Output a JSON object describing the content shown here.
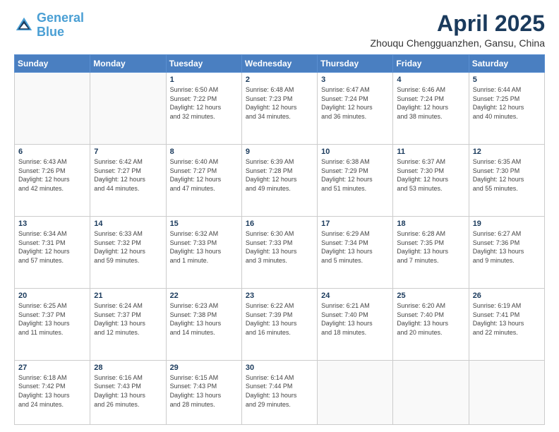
{
  "header": {
    "logo_line1": "General",
    "logo_line2": "Blue",
    "month_title": "April 2025",
    "subtitle": "Zhouqu Chengguanzhen, Gansu, China"
  },
  "weekdays": [
    "Sunday",
    "Monday",
    "Tuesday",
    "Wednesday",
    "Thursday",
    "Friday",
    "Saturday"
  ],
  "rows": [
    [
      {
        "day": "",
        "info": ""
      },
      {
        "day": "",
        "info": ""
      },
      {
        "day": "1",
        "info": "Sunrise: 6:50 AM\nSunset: 7:22 PM\nDaylight: 12 hours\nand 32 minutes."
      },
      {
        "day": "2",
        "info": "Sunrise: 6:48 AM\nSunset: 7:23 PM\nDaylight: 12 hours\nand 34 minutes."
      },
      {
        "day": "3",
        "info": "Sunrise: 6:47 AM\nSunset: 7:24 PM\nDaylight: 12 hours\nand 36 minutes."
      },
      {
        "day": "4",
        "info": "Sunrise: 6:46 AM\nSunset: 7:24 PM\nDaylight: 12 hours\nand 38 minutes."
      },
      {
        "day": "5",
        "info": "Sunrise: 6:44 AM\nSunset: 7:25 PM\nDaylight: 12 hours\nand 40 minutes."
      }
    ],
    [
      {
        "day": "6",
        "info": "Sunrise: 6:43 AM\nSunset: 7:26 PM\nDaylight: 12 hours\nand 42 minutes."
      },
      {
        "day": "7",
        "info": "Sunrise: 6:42 AM\nSunset: 7:27 PM\nDaylight: 12 hours\nand 44 minutes."
      },
      {
        "day": "8",
        "info": "Sunrise: 6:40 AM\nSunset: 7:27 PM\nDaylight: 12 hours\nand 47 minutes."
      },
      {
        "day": "9",
        "info": "Sunrise: 6:39 AM\nSunset: 7:28 PM\nDaylight: 12 hours\nand 49 minutes."
      },
      {
        "day": "10",
        "info": "Sunrise: 6:38 AM\nSunset: 7:29 PM\nDaylight: 12 hours\nand 51 minutes."
      },
      {
        "day": "11",
        "info": "Sunrise: 6:37 AM\nSunset: 7:30 PM\nDaylight: 12 hours\nand 53 minutes."
      },
      {
        "day": "12",
        "info": "Sunrise: 6:35 AM\nSunset: 7:30 PM\nDaylight: 12 hours\nand 55 minutes."
      }
    ],
    [
      {
        "day": "13",
        "info": "Sunrise: 6:34 AM\nSunset: 7:31 PM\nDaylight: 12 hours\nand 57 minutes."
      },
      {
        "day": "14",
        "info": "Sunrise: 6:33 AM\nSunset: 7:32 PM\nDaylight: 12 hours\nand 59 minutes."
      },
      {
        "day": "15",
        "info": "Sunrise: 6:32 AM\nSunset: 7:33 PM\nDaylight: 13 hours\nand 1 minute."
      },
      {
        "day": "16",
        "info": "Sunrise: 6:30 AM\nSunset: 7:33 PM\nDaylight: 13 hours\nand 3 minutes."
      },
      {
        "day": "17",
        "info": "Sunrise: 6:29 AM\nSunset: 7:34 PM\nDaylight: 13 hours\nand 5 minutes."
      },
      {
        "day": "18",
        "info": "Sunrise: 6:28 AM\nSunset: 7:35 PM\nDaylight: 13 hours\nand 7 minutes."
      },
      {
        "day": "19",
        "info": "Sunrise: 6:27 AM\nSunset: 7:36 PM\nDaylight: 13 hours\nand 9 minutes."
      }
    ],
    [
      {
        "day": "20",
        "info": "Sunrise: 6:25 AM\nSunset: 7:37 PM\nDaylight: 13 hours\nand 11 minutes."
      },
      {
        "day": "21",
        "info": "Sunrise: 6:24 AM\nSunset: 7:37 PM\nDaylight: 13 hours\nand 12 minutes."
      },
      {
        "day": "22",
        "info": "Sunrise: 6:23 AM\nSunset: 7:38 PM\nDaylight: 13 hours\nand 14 minutes."
      },
      {
        "day": "23",
        "info": "Sunrise: 6:22 AM\nSunset: 7:39 PM\nDaylight: 13 hours\nand 16 minutes."
      },
      {
        "day": "24",
        "info": "Sunrise: 6:21 AM\nSunset: 7:40 PM\nDaylight: 13 hours\nand 18 minutes."
      },
      {
        "day": "25",
        "info": "Sunrise: 6:20 AM\nSunset: 7:40 PM\nDaylight: 13 hours\nand 20 minutes."
      },
      {
        "day": "26",
        "info": "Sunrise: 6:19 AM\nSunset: 7:41 PM\nDaylight: 13 hours\nand 22 minutes."
      }
    ],
    [
      {
        "day": "27",
        "info": "Sunrise: 6:18 AM\nSunset: 7:42 PM\nDaylight: 13 hours\nand 24 minutes."
      },
      {
        "day": "28",
        "info": "Sunrise: 6:16 AM\nSunset: 7:43 PM\nDaylight: 13 hours\nand 26 minutes."
      },
      {
        "day": "29",
        "info": "Sunrise: 6:15 AM\nSunset: 7:43 PM\nDaylight: 13 hours\nand 28 minutes."
      },
      {
        "day": "30",
        "info": "Sunrise: 6:14 AM\nSunset: 7:44 PM\nDaylight: 13 hours\nand 29 minutes."
      },
      {
        "day": "",
        "info": ""
      },
      {
        "day": "",
        "info": ""
      },
      {
        "day": "",
        "info": ""
      }
    ]
  ]
}
